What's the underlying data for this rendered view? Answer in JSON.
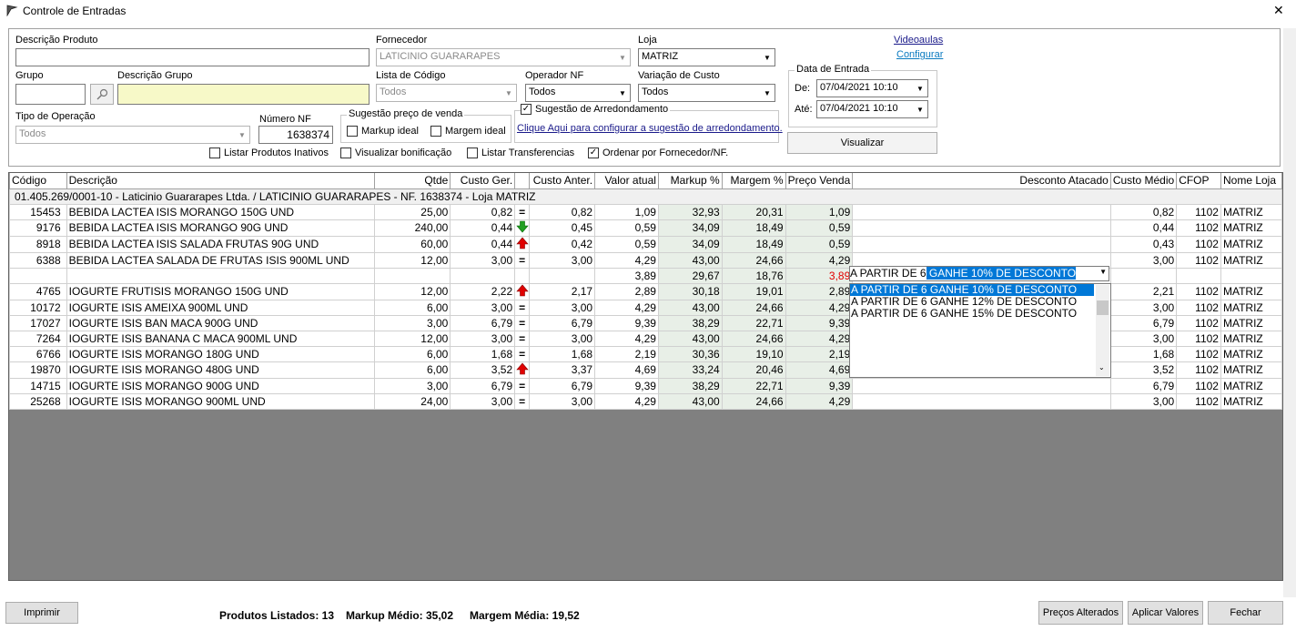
{
  "window": {
    "title": "Controle de Entradas",
    "close": "✕"
  },
  "filters": {
    "descricao_produto_label": "Descrição Produto",
    "descricao_produto_value": "",
    "fornecedor_label": "Fornecedor",
    "fornecedor_value": "LATICINIO GUARARAPES",
    "loja_label": "Loja",
    "loja_value": "MATRIZ",
    "grupo_label": "Grupo",
    "grupo_value": "",
    "descricao_grupo_label": "Descrição Grupo",
    "descricao_grupo_value": "",
    "lista_codigo_label": "Lista de Código",
    "lista_codigo_value": "Todos",
    "operador_nf_label": "Operador NF",
    "operador_nf_value": "Todos",
    "variacao_custo_label": "Variação de Custo",
    "variacao_custo_value": "Todos",
    "tipo_operacao_label": "Tipo de Operação",
    "tipo_operacao_value": "Todos",
    "numero_nf_label": "Número NF",
    "numero_nf_value": "1638374",
    "sugestao_group_label": "Sugestão preço de venda",
    "markup_ideal_label": "Markup ideal",
    "margem_ideal_label": "Margem ideal",
    "sugestao_arred_label": "Sugestão de Arredondamento",
    "sugestao_arred_link": "Clique Aqui para configurar a sugestão de arredondamento.",
    "listar_inativos_label": "Listar Produtos Inativos",
    "visualizar_bonificacao_label": "Visualizar bonificação",
    "listar_transferencias_label": "Listar Transferencias",
    "ordenar_fornecedor_label": "Ordenar por Fornecedor/NF."
  },
  "links": {
    "videoaulas": "Videoaulas",
    "configurar": "Configurar"
  },
  "data_entrada": {
    "label": "Data de Entrada",
    "de_label": "De:",
    "de_value": "07/04/2021 10:10",
    "ate_label": "Até:",
    "ate_value": "07/04/2021 10:10"
  },
  "buttons": {
    "visualizar": "Visualizar",
    "imprimir": "Imprimir",
    "precos_alterados": "Preços Alterados",
    "aplicar_valores": "Aplicar Valores",
    "fechar": "Fechar"
  },
  "grid": {
    "columns": [
      "Código",
      "Descrição",
      "Qtde",
      "Custo Ger.",
      "",
      "Custo Anter.",
      "Valor atual",
      "Markup %",
      "Margem %",
      "Preço Venda",
      "Desconto Atacado",
      "Custo Médio",
      "CFOP",
      "Nome Loja"
    ],
    "group_header": "01.405.269/0001-10  -  Laticinio Guararapes Ltda. / LATICINIO GUARARAPES  -  NF. 1638374  -  Loja MATRIZ",
    "rows": [
      {
        "codigo": "15453",
        "descricao": "BEBIDA LACTEA ISIS MORANGO 150G UND",
        "qtde": "25,00",
        "custo_ger": "0,82",
        "ind": "=",
        "custo_anter": "0,82",
        "valor_atual": "1,09",
        "markup": "32,93",
        "margem": "20,31",
        "preco_venda": "1,09",
        "desconto": "",
        "custo_medio": "0,82",
        "cfop": "1102",
        "loja": "MATRIZ"
      },
      {
        "codigo": "9176",
        "descricao": "BEBIDA LACTEA ISIS MORANGO 90G UND",
        "qtde": "240,00",
        "custo_ger": "0,44",
        "ind": "down",
        "custo_anter": "0,45",
        "valor_atual": "0,59",
        "markup": "34,09",
        "margem": "18,49",
        "preco_venda": "0,59",
        "desconto": "",
        "custo_medio": "0,44",
        "cfop": "1102",
        "loja": "MATRIZ"
      },
      {
        "codigo": "8918",
        "descricao": "BEBIDA LACTEA ISIS SALADA FRUTAS 90G UND",
        "qtde": "60,00",
        "custo_ger": "0,44",
        "ind": "up",
        "custo_anter": "0,42",
        "valor_atual": "0,59",
        "markup": "34,09",
        "margem": "18,49",
        "preco_venda": "0,59",
        "desconto": "",
        "custo_medio": "0,43",
        "cfop": "1102",
        "loja": "MATRIZ"
      },
      {
        "codigo": "6388",
        "descricao": "BEBIDA LACTEA SALADA DE FRUTAS ISIS 900ML UND",
        "qtde": "12,00",
        "custo_ger": "3,00",
        "ind": "=",
        "custo_anter": "3,00",
        "valor_atual": "4,29",
        "markup": "43,00",
        "margem": "24,66",
        "preco_venda": "4,29",
        "desconto": "",
        "custo_medio": "3,00",
        "cfop": "1102",
        "loja": "MATRIZ"
      },
      {
        "codigo": "",
        "descricao": "",
        "qtde": "",
        "custo_ger": "",
        "ind": "",
        "custo_anter": "",
        "valor_atual": "3,89",
        "markup": "29,67",
        "margem": "18,76",
        "preco_venda": "3,89",
        "desconto": "",
        "custo_medio": "",
        "cfop": "",
        "loja": "",
        "red_price": true
      },
      {
        "codigo": "4765",
        "descricao": "IOGURTE FRUTISIS MORANGO 150G UND",
        "qtde": "12,00",
        "custo_ger": "2,22",
        "ind": "up",
        "custo_anter": "2,17",
        "valor_atual": "2,89",
        "markup": "30,18",
        "margem": "19,01",
        "preco_venda": "2,89",
        "desconto": "",
        "custo_medio": "2,21",
        "cfop": "1102",
        "loja": "MATRIZ"
      },
      {
        "codigo": "10172",
        "descricao": "IOGURTE ISIS AMEIXA 900ML UND",
        "qtde": "6,00",
        "custo_ger": "3,00",
        "ind": "=",
        "custo_anter": "3,00",
        "valor_atual": "4,29",
        "markup": "43,00",
        "margem": "24,66",
        "preco_venda": "4,29",
        "desconto": "",
        "custo_medio": "3,00",
        "cfop": "1102",
        "loja": "MATRIZ"
      },
      {
        "codigo": "17027",
        "descricao": "IOGURTE ISIS BAN MACA 900G UND",
        "qtde": "3,00",
        "custo_ger": "6,79",
        "ind": "=",
        "custo_anter": "6,79",
        "valor_atual": "9,39",
        "markup": "38,29",
        "margem": "22,71",
        "preco_venda": "9,39",
        "desconto": "",
        "custo_medio": "6,79",
        "cfop": "1102",
        "loja": "MATRIZ"
      },
      {
        "codigo": "7264",
        "descricao": "IOGURTE ISIS BANANA C  MACA 900ML UND",
        "qtde": "12,00",
        "custo_ger": "3,00",
        "ind": "=",
        "custo_anter": "3,00",
        "valor_atual": "4,29",
        "markup": "43,00",
        "margem": "24,66",
        "preco_venda": "4,29",
        "desconto": "",
        "custo_medio": "3,00",
        "cfop": "1102",
        "loja": "MATRIZ"
      },
      {
        "codigo": "6766",
        "descricao": "IOGURTE ISIS MORANGO 180G UND",
        "qtde": "6,00",
        "custo_ger": "1,68",
        "ind": "=",
        "custo_anter": "1,68",
        "valor_atual": "2,19",
        "markup": "30,36",
        "margem": "19,10",
        "preco_venda": "2,19",
        "desconto": "",
        "custo_medio": "1,68",
        "cfop": "1102",
        "loja": "MATRIZ"
      },
      {
        "codigo": "19870",
        "descricao": "IOGURTE ISIS MORANGO 480G UND",
        "qtde": "6,00",
        "custo_ger": "3,52",
        "ind": "up",
        "custo_anter": "3,37",
        "valor_atual": "4,69",
        "markup": "33,24",
        "margem": "20,46",
        "preco_venda": "4,69",
        "desconto": "",
        "custo_medio": "3,52",
        "cfop": "1102",
        "loja": "MATRIZ"
      },
      {
        "codigo": "14715",
        "descricao": "IOGURTE ISIS MORANGO 900G UND",
        "qtde": "3,00",
        "custo_ger": "6,79",
        "ind": "=",
        "custo_anter": "6,79",
        "valor_atual": "9,39",
        "markup": "38,29",
        "margem": "22,71",
        "preco_venda": "9,39",
        "desconto": "",
        "custo_medio": "6,79",
        "cfop": "1102",
        "loja": "MATRIZ"
      },
      {
        "codigo": "25268",
        "descricao": "IOGURTE ISIS MORANGO 900ML UND",
        "qtde": "24,00",
        "custo_ger": "3,00",
        "ind": "=",
        "custo_anter": "3,00",
        "valor_atual": "4,29",
        "markup": "43,00",
        "margem": "24,66",
        "preco_venda": "4,29",
        "desconto": "",
        "custo_medio": "3,00",
        "cfop": "1102",
        "loja": "MATRIZ"
      }
    ]
  },
  "desconto_dropdown": {
    "current_prefix": "A PARTIR DE 6",
    "current_selected": " GANHE 10% DE DESCONTO",
    "options": [
      "A PARTIR DE 6 GANHE 10% DE DESCONTO",
      "A PARTIR DE 6 GANHE 12% DE DESCONTO",
      "A PARTIR DE 6 GANHE 15% DE DESCONTO"
    ]
  },
  "status": {
    "produtos": "Produtos Listados: 13",
    "markup": "Markup Médio: 35,02",
    "margem": "Margem Média: 19,52"
  },
  "colors": {
    "accent": "#0078d7",
    "grid_bg": "#808080",
    "shade": "#e8efe7",
    "up": "#e00000",
    "down": "#22a022"
  },
  "icons": {
    "app": "app-icon",
    "search": "search-icon",
    "arrow_up": "arrow-up-icon",
    "arrow_down": "arrow-down-icon",
    "equal": "equal-icon"
  }
}
